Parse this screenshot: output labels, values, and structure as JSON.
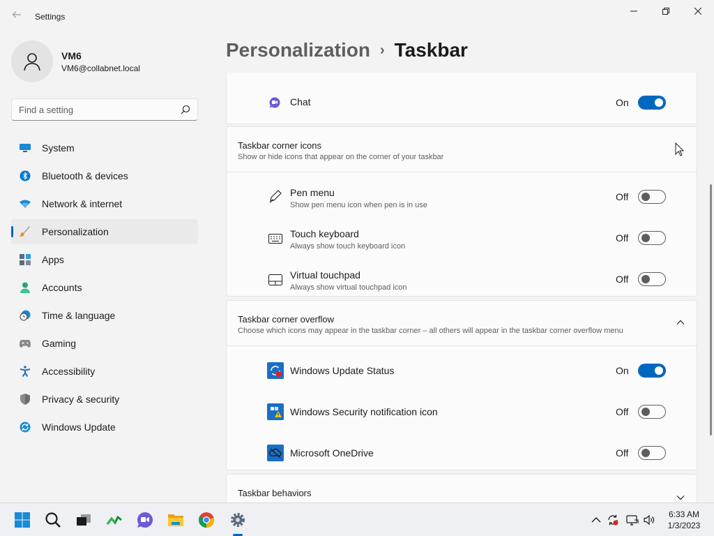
{
  "window": {
    "title": "Settings",
    "back_icon": "back-arrow-icon",
    "minimize_icon": "minimize-icon",
    "maximize_icon": "restore-icon",
    "close_icon": "close-icon"
  },
  "profile": {
    "name": "VM6",
    "email": "VM6@collabnet.local"
  },
  "search": {
    "placeholder": "Find a setting"
  },
  "sidebar": {
    "items": [
      {
        "label": "System",
        "icon": "system-icon"
      },
      {
        "label": "Bluetooth & devices",
        "icon": "bluetooth-icon"
      },
      {
        "label": "Network & internet",
        "icon": "wifi-icon"
      },
      {
        "label": "Personalization",
        "icon": "brush-icon",
        "active": true
      },
      {
        "label": "Apps",
        "icon": "apps-icon"
      },
      {
        "label": "Accounts",
        "icon": "accounts-icon"
      },
      {
        "label": "Time & language",
        "icon": "clock-globe-icon"
      },
      {
        "label": "Gaming",
        "icon": "gamepad-icon"
      },
      {
        "label": "Accessibility",
        "icon": "accessibility-icon"
      },
      {
        "label": "Privacy & security",
        "icon": "shield-icon"
      },
      {
        "label": "Windows Update",
        "icon": "update-icon"
      }
    ]
  },
  "header": {
    "parent": "Personalization",
    "separator": "›",
    "current": "Taskbar"
  },
  "chat_row": {
    "label": "Chat",
    "state": "On",
    "icon": "chat-icon"
  },
  "corner_icons": {
    "title": "Taskbar corner icons",
    "subtitle": "Show or hide icons that appear on the corner of your taskbar",
    "rows": [
      {
        "label": "Pen menu",
        "desc": "Show pen menu icon when pen is in use",
        "state": "Off",
        "icon": "pen-icon"
      },
      {
        "label": "Touch keyboard",
        "desc": "Always show touch keyboard icon",
        "state": "Off",
        "icon": "keyboard-icon"
      },
      {
        "label": "Virtual touchpad",
        "desc": "Always show virtual touchpad icon",
        "state": "Off",
        "icon": "touchpad-icon"
      }
    ]
  },
  "corner_overflow": {
    "title": "Taskbar corner overflow",
    "subtitle": "Choose which icons may appear in the taskbar corner – all others will appear in the taskbar corner overflow menu",
    "rows": [
      {
        "label": "Windows Update Status",
        "state": "On",
        "icon": "windows-update-status-icon"
      },
      {
        "label": "Windows Security notification icon",
        "state": "Off",
        "icon": "windows-security-icon"
      },
      {
        "label": "Microsoft OneDrive",
        "state": "Off",
        "icon": "onedrive-icon"
      }
    ]
  },
  "behaviors": {
    "title": "Taskbar behaviors"
  },
  "taskbar": {
    "apps": [
      "start-icon",
      "search-icon",
      "task-view-icon",
      "widgets-icon",
      "chat-icon",
      "file-explorer-icon",
      "chrome-icon",
      "settings-icon"
    ],
    "tray": [
      "chevron-up-icon",
      "windows-update-tray-icon",
      "network-icon",
      "volume-icon"
    ],
    "time": "6:33 AM",
    "date": "1/3/2023"
  },
  "colors": {
    "accent": "#0067c0",
    "background": "#f3f3f3",
    "card": "#fbfbfb"
  }
}
